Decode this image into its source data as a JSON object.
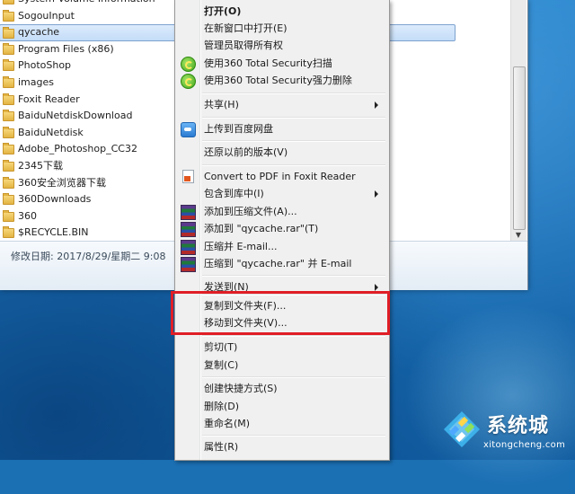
{
  "explorer": {
    "files": [
      {
        "name": "System Volume Information",
        "selected": false
      },
      {
        "name": "SogouInput",
        "selected": false
      },
      {
        "name": "qycache",
        "selected": true
      },
      {
        "name": "Program Files (x86)",
        "selected": false
      },
      {
        "name": "PhotoShop",
        "selected": false
      },
      {
        "name": "images",
        "selected": false
      },
      {
        "name": "Foxit Reader",
        "selected": false
      },
      {
        "name": "BaiduNetdiskDownload",
        "selected": false
      },
      {
        "name": "BaiduNetdisk",
        "selected": false
      },
      {
        "name": "Adobe_Photoshop_CC32",
        "selected": false
      },
      {
        "name": "2345下载",
        "selected": false
      },
      {
        "name": "360安全浏览器下载",
        "selected": false
      },
      {
        "name": "360Downloads",
        "selected": false
      },
      {
        "name": "360",
        "selected": false
      },
      {
        "name": "$RECYCLE.BIN",
        "selected": false
      }
    ],
    "status": "修改日期: 2017/8/29/星期二 9:08"
  },
  "context_menu": {
    "items": [
      {
        "label": "打开(O)",
        "bold": true,
        "icon": "",
        "submenu": false,
        "sep_before": false
      },
      {
        "label": "在新窗口中打开(E)",
        "bold": false,
        "icon": "",
        "submenu": false,
        "sep_before": false
      },
      {
        "label": "管理员取得所有权",
        "bold": false,
        "icon": "",
        "submenu": false,
        "sep_before": false
      },
      {
        "label": "使用360 Total Security扫描",
        "bold": false,
        "icon": "360-icon",
        "submenu": false,
        "sep_before": false
      },
      {
        "label": "使用360 Total Security强力删除",
        "bold": false,
        "icon": "360-icon",
        "submenu": false,
        "sep_before": false
      },
      {
        "label": "共享(H)",
        "bold": false,
        "icon": "",
        "submenu": true,
        "sep_before": true
      },
      {
        "label": "上传到百度网盘",
        "bold": false,
        "icon": "baidu-netdisk-icon",
        "submenu": false,
        "sep_before": true
      },
      {
        "label": "还原以前的版本(V)",
        "bold": false,
        "icon": "",
        "submenu": false,
        "sep_before": true
      },
      {
        "label": "Convert to PDF in Foxit Reader",
        "bold": false,
        "icon": "foxit-pdf-icon",
        "submenu": false,
        "sep_before": true
      },
      {
        "label": "包含到库中(I)",
        "bold": false,
        "icon": "",
        "submenu": true,
        "sep_before": false
      },
      {
        "label": "添加到压缩文件(A)...",
        "bold": false,
        "icon": "winrar-icon",
        "submenu": false,
        "sep_before": false
      },
      {
        "label": "添加到 \"qycache.rar\"(T)",
        "bold": false,
        "icon": "winrar-icon",
        "submenu": false,
        "sep_before": false
      },
      {
        "label": "压缩并 E-mail...",
        "bold": false,
        "icon": "winrar-icon",
        "submenu": false,
        "sep_before": false
      },
      {
        "label": "压缩到 \"qycache.rar\" 并 E-mail",
        "bold": false,
        "icon": "winrar-icon",
        "submenu": false,
        "sep_before": false
      },
      {
        "label": "发送到(N)",
        "bold": false,
        "icon": "",
        "submenu": true,
        "sep_before": true
      },
      {
        "label": "复制到文件夹(F)...",
        "bold": false,
        "icon": "",
        "submenu": false,
        "sep_before": true
      },
      {
        "label": "移动到文件夹(V)...",
        "bold": false,
        "icon": "",
        "submenu": false,
        "sep_before": false
      },
      {
        "label": "剪切(T)",
        "bold": false,
        "icon": "",
        "submenu": false,
        "sep_before": true
      },
      {
        "label": "复制(C)",
        "bold": false,
        "icon": "",
        "submenu": false,
        "sep_before": false
      },
      {
        "label": "创建快捷方式(S)",
        "bold": false,
        "icon": "",
        "submenu": false,
        "sep_before": true
      },
      {
        "label": "删除(D)",
        "bold": false,
        "icon": "",
        "submenu": false,
        "sep_before": false
      },
      {
        "label": "重命名(M)",
        "bold": false,
        "icon": "",
        "submenu": false,
        "sep_before": false
      },
      {
        "label": "属性(R)",
        "bold": false,
        "icon": "",
        "submenu": false,
        "sep_before": true
      }
    ]
  },
  "highlight": {
    "color": "#e01e26"
  },
  "watermark": {
    "title": "系统城",
    "url": "xitongcheng.com"
  }
}
